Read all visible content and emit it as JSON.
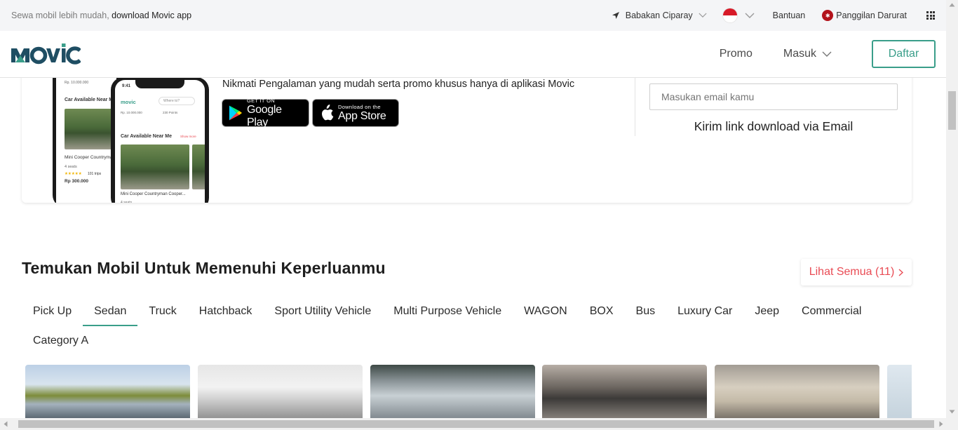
{
  "topbar": {
    "promo_text": "Sewa mobil lebih mudah,",
    "promo_link": "download Movic app",
    "location": "Babakan Ciparay",
    "help": "Bantuan",
    "emergency": "Panggilan Darurat"
  },
  "nav": {
    "logo_text": "MOVIC",
    "promo": "Promo",
    "login": "Masuk",
    "register": "Daftar"
  },
  "download": {
    "tagline": "Nikmati Pengalaman yang mudah serta promo khusus hanya di aplikasi Movic",
    "google_small": "GET IT ON",
    "google_big": "Google Play",
    "apple_small": "Download on the",
    "apple_big": "App Store",
    "email_placeholder": "Masukan email kamu",
    "send_link": "Kirim link download via Email",
    "phone": {
      "time": "9:41",
      "app_name": "movic",
      "search_hint": "Where to?",
      "section": "Car Available Near Me",
      "see_more": "Show more",
      "car_name": "Mini Cooper Countryman Cooper...",
      "car_name_back": "Mini Cooper Countryma",
      "seats": "4 seats",
      "trips": "101 trips",
      "price": "Rp 300.000",
      "balance": "Rp. 10.000.000",
      "points": "230 Points"
    }
  },
  "section": {
    "title": "Temukan Mobil Untuk Memenuhi Keperluanmu",
    "see_all": "Lihat Semua (11)"
  },
  "categories": [
    {
      "label": "Pick Up",
      "active": false
    },
    {
      "label": "Sedan",
      "active": true
    },
    {
      "label": "Truck",
      "active": false
    },
    {
      "label": "Hatchback",
      "active": false
    },
    {
      "label": "Sport Utility Vehicle",
      "active": false
    },
    {
      "label": "Multi Purpose Vehicle",
      "active": false
    },
    {
      "label": "WAGON",
      "active": false
    },
    {
      "label": "BOX",
      "active": false
    },
    {
      "label": "Bus",
      "active": false
    },
    {
      "label": "Luxury Car",
      "active": false
    },
    {
      "label": "Jeep",
      "active": false
    },
    {
      "label": "Commercial",
      "active": false
    },
    {
      "label": "Category A",
      "active": false
    }
  ],
  "colors": {
    "brand": "#1f4e63",
    "accent": "#3a9e8a",
    "see_all": "#e94b54",
    "emergency": "#b3131b"
  },
  "icons": [
    "navigation-arrow-icon",
    "chevron-down-icon",
    "indonesia-flag-icon",
    "emergency-icon",
    "apps-grid-icon",
    "google-play-icon",
    "apple-icon",
    "chevron-right-icon"
  ]
}
